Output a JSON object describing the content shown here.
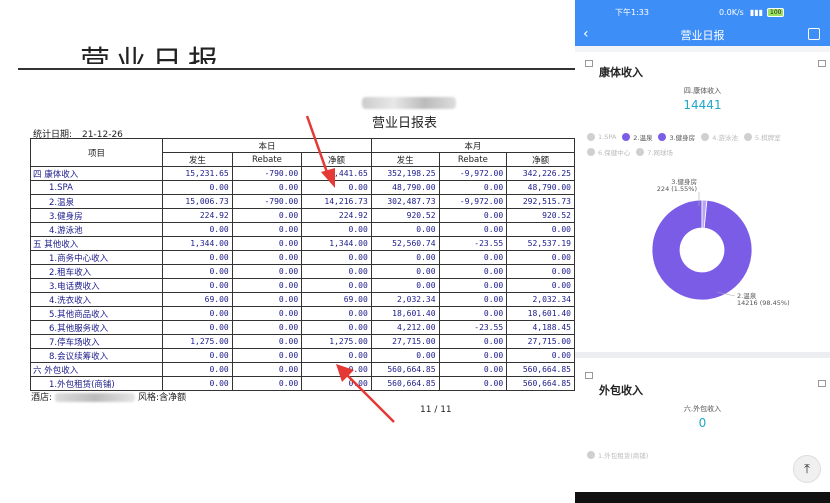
{
  "report": {
    "cut_title": "营业日报",
    "title": "营业日报表",
    "date_label": "统计日期:",
    "date_value": "21-12-26",
    "col_item": "项目",
    "col_today": "本日",
    "col_month": "本月",
    "col_occur": "发生",
    "col_rebate": "Rebate",
    "col_net": "净额",
    "rows": [
      {
        "kind": "group",
        "name": "四 康体收入",
        "d": [
          "15,231.65",
          "-790.00",
          "14,441.65"
        ],
        "m": [
          "352,198.25",
          "-9,972.00",
          "342,226.25"
        ]
      },
      {
        "kind": "sub",
        "name": "1.SPA",
        "d": [
          "0.00",
          "0.00",
          "0.00"
        ],
        "m": [
          "48,790.00",
          "0.00",
          "48,790.00"
        ]
      },
      {
        "kind": "sub",
        "name": "2.温泉",
        "d": [
          "15,006.73",
          "-790.00",
          "14,216.73"
        ],
        "m": [
          "302,487.73",
          "-9,972.00",
          "292,515.73"
        ]
      },
      {
        "kind": "sub",
        "name": "3.健身房",
        "d": [
          "224.92",
          "0.00",
          "224.92"
        ],
        "m": [
          "920.52",
          "0.00",
          "920.52"
        ]
      },
      {
        "kind": "sub",
        "name": "4.游泳池",
        "d": [
          "0.00",
          "0.00",
          "0.00"
        ],
        "m": [
          "0.00",
          "0.00",
          "0.00"
        ]
      },
      {
        "kind": "group",
        "name": "五 其他收入",
        "d": [
          "1,344.00",
          "0.00",
          "1,344.00"
        ],
        "m": [
          "52,560.74",
          "-23.55",
          "52,537.19"
        ]
      },
      {
        "kind": "sub",
        "name": "1.商务中心收入",
        "d": [
          "0.00",
          "0.00",
          "0.00"
        ],
        "m": [
          "0.00",
          "0.00",
          "0.00"
        ]
      },
      {
        "kind": "sub",
        "name": "2.租车收入",
        "d": [
          "0.00",
          "0.00",
          "0.00"
        ],
        "m": [
          "0.00",
          "0.00",
          "0.00"
        ]
      },
      {
        "kind": "sub",
        "name": "3.电话费收入",
        "d": [
          "0.00",
          "0.00",
          "0.00"
        ],
        "m": [
          "0.00",
          "0.00",
          "0.00"
        ]
      },
      {
        "kind": "sub",
        "name": "4.洗衣收入",
        "d": [
          "69.00",
          "0.00",
          "69.00"
        ],
        "m": [
          "2,032.34",
          "0.00",
          "2,032.34"
        ]
      },
      {
        "kind": "sub",
        "name": "5.其他商品收入",
        "d": [
          "0.00",
          "0.00",
          "0.00"
        ],
        "m": [
          "18,601.40",
          "0.00",
          "18,601.40"
        ]
      },
      {
        "kind": "sub",
        "name": "6.其他服务收入",
        "d": [
          "0.00",
          "0.00",
          "0.00"
        ],
        "m": [
          "4,212.00",
          "-23.55",
          "4,188.45"
        ]
      },
      {
        "kind": "sub",
        "name": "7.停车场收入",
        "d": [
          "1,275.00",
          "0.00",
          "1,275.00"
        ],
        "m": [
          "27,715.00",
          "0.00",
          "27,715.00"
        ]
      },
      {
        "kind": "sub",
        "name": "8.会议续筹收入",
        "d": [
          "0.00",
          "0.00",
          "0.00"
        ],
        "m": [
          "0.00",
          "0.00",
          "0.00"
        ]
      },
      {
        "kind": "group",
        "name": "六 外包收入",
        "d": [
          "0.00",
          "0.00",
          "0.00"
        ],
        "m": [
          "560,664.85",
          "0.00",
          "560,664.85"
        ]
      },
      {
        "kind": "sub",
        "name": "1.外包租赁(商铺)",
        "d": [
          "0.00",
          "0.00",
          "0.00"
        ],
        "m": [
          "560,664.85",
          "0.00",
          "560,664.85"
        ]
      }
    ],
    "hotel_label": "酒店:",
    "style_label": "风格:含净额",
    "page": "11 / 11"
  },
  "app": {
    "time": "下午1:33",
    "net_speed": "0.0K/s",
    "battery": "100",
    "nav_title": "营业日报",
    "back_icon": "‹",
    "card1": {
      "title": "康体收入",
      "series_label": "四.康体收入",
      "value": "14441",
      "legend": [
        {
          "label": "1.SPA",
          "on": false
        },
        {
          "label": "2.温泉",
          "on": true
        },
        {
          "label": "3.健身房",
          "on": true
        },
        {
          "label": "4.游泳池",
          "on": false
        },
        {
          "label": "5.棋牌室",
          "on": false
        },
        {
          "label": "6.保健中心",
          "on": false
        },
        {
          "label": "7.网球场",
          "on": false
        }
      ],
      "slice_label_small": "3.健身房",
      "slice_value_small": "224 (1.55%)",
      "slice_label_big": "2.温泉",
      "slice_value_big": "14216 (98.45%)"
    },
    "card2": {
      "title": "外包收入",
      "series_label": "六.外包收入",
      "value": "0",
      "legend": [
        {
          "label": "1.外包租赁(商铺)",
          "on": false
        }
      ]
    },
    "scroll_top_icon": "⤒"
  },
  "chart_data": {
    "type": "pie",
    "title": "康体收入",
    "categories": [
      "2.温泉",
      "3.健身房"
    ],
    "values": [
      14216,
      224
    ],
    "percent": [
      98.45,
      1.55
    ],
    "colors": [
      "#7b5ce6",
      "#b8a6f2"
    ]
  }
}
